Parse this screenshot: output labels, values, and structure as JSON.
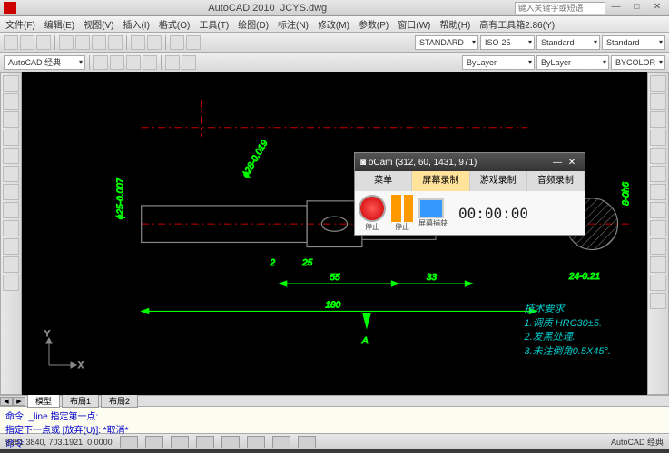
{
  "title": {
    "app": "AutoCAD 2010",
    "file": "JCYS.dwg",
    "search_placeholder": "键入关键字或短语"
  },
  "menubar": [
    "文件(F)",
    "编辑(E)",
    "视图(V)",
    "插入(I)",
    "格式(O)",
    "工具(T)",
    "绘图(D)",
    "标注(N)",
    "修改(M)",
    "参数(P)",
    "窗口(W)",
    "帮助(H)",
    "高有工具箱2.86(Y)"
  ],
  "toolbar2": {
    "workspace": "AutoCAD 经典",
    "layer": "ByLayer",
    "color": "ByLayer",
    "bycolor": "BYCOLOR",
    "std1": "STANDARD",
    "iso": "ISO-25",
    "std2": "Standard",
    "std3": "Standard"
  },
  "drawing": {
    "dims": {
      "d180": "180",
      "d55": "55",
      "d33": "33",
      "d25": "25",
      "d2": "2",
      "d24": "24-0.21",
      "phi28": "ϕ28-0.019",
      "phi25": "ϕ25-0.007",
      "h8": "8-0h6"
    },
    "section": {
      "a1": "A",
      "a2": "A"
    },
    "tech": {
      "title": "技术要求",
      "l1": "1.调质 HRC30±5.",
      "l2": "2.发黑处理.",
      "l3": "3.未注倒角0.5X45°."
    }
  },
  "tabs": {
    "model": "模型",
    "layout1": "布局1",
    "layout2": "布局2"
  },
  "cmd": {
    "l1": "命令: _line 指定第一点:",
    "l2": "指定下一点或 [放弃(U)]: *取消*",
    "l3": "命令:"
  },
  "status": {
    "coords": "9281.3840, 703.1921, 0.0000",
    "right": "AutoCAD 经典"
  },
  "ocam": {
    "title_prefix": "oCam",
    "title_coords": "(312, 60, 1431, 971)",
    "tabs": [
      "菜单",
      "屏幕录制",
      "游戏录制",
      "音频录制"
    ],
    "rec": "停止",
    "pause": "停止",
    "capture": "屏幕捕获",
    "time": "00:00:00"
  }
}
